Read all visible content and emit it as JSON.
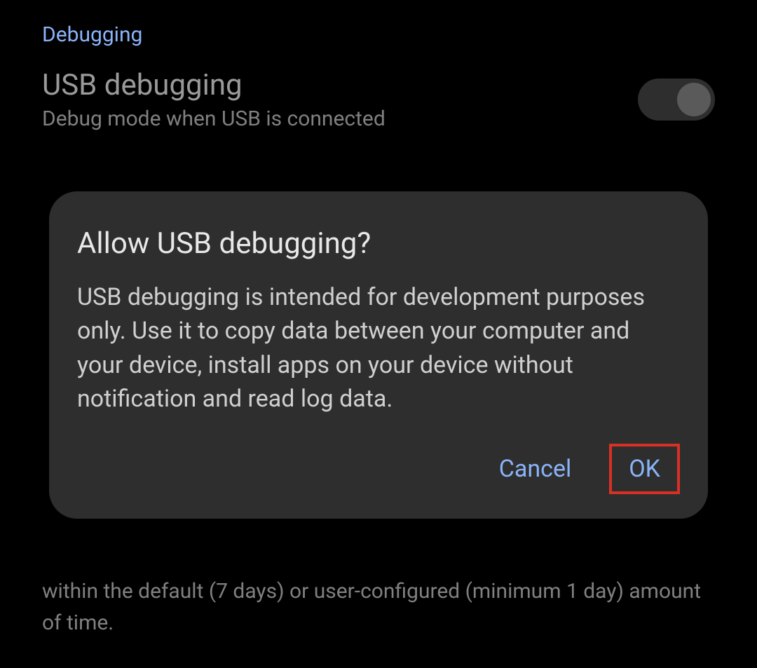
{
  "section": {
    "header": "Debugging"
  },
  "settings": {
    "usb_debugging": {
      "title": "USB debugging",
      "subtitle": "Debug mode when USB is connected"
    }
  },
  "background_partial": "within the default (7 days) or user-configured (minimum 1 day) amount of time.",
  "dialog": {
    "title": "Allow USB debugging?",
    "body": "USB debugging is intended for development purposes only. Use it to copy data between your computer and your device, install apps on your device without notification and read log data.",
    "cancel": "Cancel",
    "ok": "OK"
  },
  "highlight": {
    "target": "ok-button",
    "color": "#d93025"
  }
}
